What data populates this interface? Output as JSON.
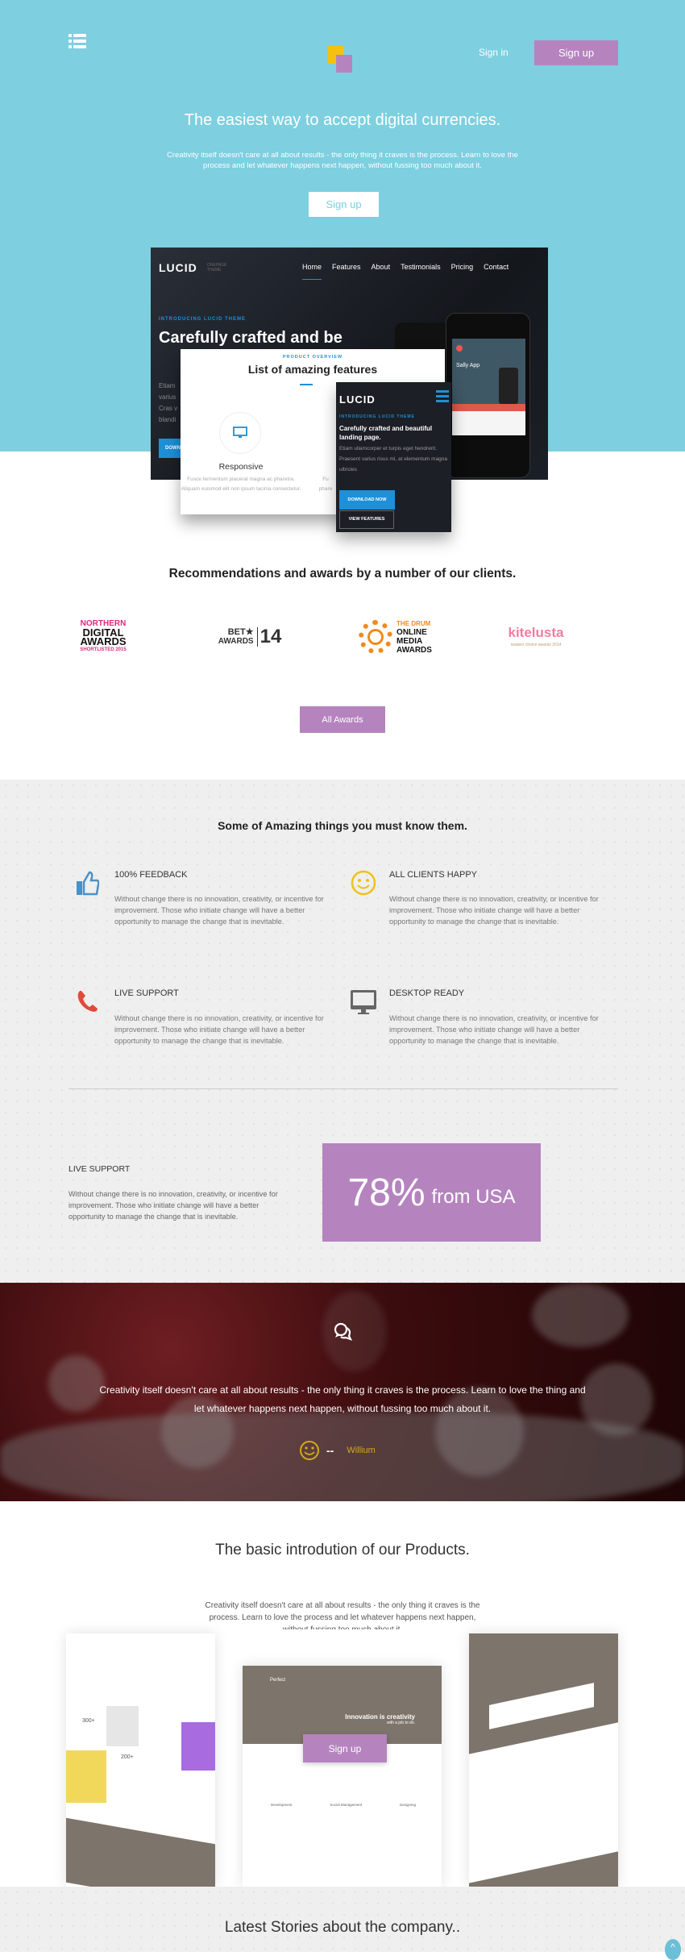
{
  "colors": {
    "hero_bg": "#7ecfe0",
    "accent_purple": "#b584bf",
    "logo_yellow": "#f4c20d",
    "mock_blue": "#1e90d8",
    "quote_author": "#d4aa1a"
  },
  "header": {
    "menu_icon": "list-icon",
    "sign_in": "Sign in",
    "sign_up": "Sign up"
  },
  "hero": {
    "title": "The easiest way to accept digital currencies.",
    "text": "Creativity itself doesn't care at all about results - the only thing it craves is the process. Learn to love the process and let whatever happens next happen, without fussing too much about it.",
    "cta": "Sign up"
  },
  "mockup": {
    "brand": "LUCID",
    "brand_sub": "ONEPAGE THEME",
    "nav": [
      "Home",
      "Features",
      "About",
      "Testimonials",
      "Pricing",
      "Contact"
    ],
    "kicker": "INTRODUCING LUCID THEME",
    "headline": "Carefully crafted and be",
    "body_lines": [
      "Etiam",
      "varius",
      "Cras v",
      "blandi"
    ],
    "download_short": "DOWN",
    "card_kicker": "PRODUCT OVERVIEW",
    "card_title": "List of amazing features",
    "card_feature": "Responsive",
    "card_feature_text": "Fusce fermentum placerat magna ac pharetra. Aliquam euismod elit non ipsum lacinia consectetur.",
    "card_partial": "Fu phare",
    "tablet_kicker": "INTRODUCING LUCID THEME",
    "tablet_headline": "Carefully crafted and beautiful landing page.",
    "tablet_text": "Etiam ullamcorper et turpis eget hendrerit. Praesent varius risus mi, at elementum magna ultricies",
    "download": "DOWNLOAD NOW",
    "view": "VIEW FEATURES",
    "phone_app": "Sally App"
  },
  "awards": {
    "title": "Recommendations and awards by a number of our clients.",
    "logos": [
      {
        "lines": [
          "NORTHERN",
          "DIGITAL",
          "AWARDS",
          "SHORTLISTED 2015"
        ]
      },
      {
        "lines": [
          "BET★",
          "AWARDS",
          "14"
        ]
      },
      {
        "lines": [
          "THE DRUM",
          "ONLINE",
          "MEDIA",
          "AWARDS"
        ]
      },
      {
        "lines": [
          "kitelusta",
          "readers choice awards 2014"
        ]
      }
    ],
    "button": "All Awards"
  },
  "features": {
    "title": "Some of Amazing things you must know them.",
    "items": [
      {
        "icon": "thumbs-up-icon",
        "title": "100% FEEDBACK",
        "text": "Without change there is no innovation, creativity, or incentive for improvement. Those who initiate change will have a better opportunity to manage the change that is inevitable."
      },
      {
        "icon": "smiley-icon",
        "title": "ALL CLIENTS HAPPY",
        "text": "Without change there is no innovation, creativity, or incentive for improvement. Those who initiate change will have a better opportunity to manage the change that is inevitable."
      },
      {
        "icon": "phone-icon",
        "title": "LIVE SUPPORT",
        "text": "Without change there is no innovation, creativity, or incentive for improvement. Those who initiate change will have a better opportunity to manage the change that is inevitable."
      },
      {
        "icon": "monitor-icon",
        "title": "DESKTOP READY",
        "text": "Without change there is no innovation, creativity, or incentive for improvement. Those who initiate change will have a better opportunity to manage the change that is inevitable."
      }
    ]
  },
  "stat": {
    "title": "LIVE SUPPORT",
    "text": "Without change there is no innovation, creativity, or incentive for improvement. Those who initiate change will have a better opportunity to manage the change that is inevitable.",
    "percent": "78%",
    "label": "from USA",
    "value": 78
  },
  "testimonial": {
    "icon": "chat-bubbles-icon",
    "quote": "Creativity itself doesn't care at all about results - the only thing it craves is the process. Learn to love the thing and let whatever happens next happen, without fussing too much about it.",
    "dash": "--",
    "author": "Willium"
  },
  "products": {
    "title": "The basic introdution of our Products.",
    "text": "Creativity itself doesn't care at all about results - the only thing it craves is the process. Learn to love the process and let whatever happens next happen, without fussing too much about it.",
    "middle": {
      "brand": "Perfect",
      "headline": "Innovation is creativity",
      "sub": "with a job to do.",
      "cta": "Sign up",
      "services": [
        "Development",
        "Social Management",
        "Designing"
      ]
    },
    "left": {
      "stat1": "300+",
      "stat2": "200+"
    }
  },
  "stories": {
    "title": "Latest Stories about the company.."
  },
  "scroll_top": "^"
}
